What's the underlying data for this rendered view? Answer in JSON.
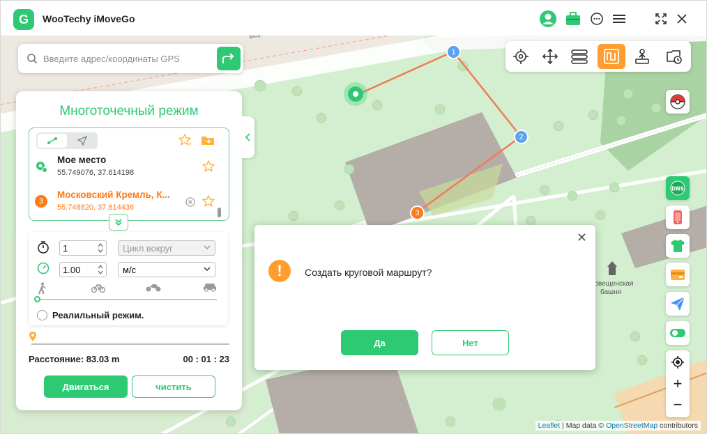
{
  "app": {
    "title": "WooTechy iMoveGo",
    "logo_letter": "G"
  },
  "search": {
    "placeholder": "Введите адрес/координаты GPS"
  },
  "map_labels": {
    "street": "Боровиц",
    "tower_line1": "говещенская",
    "tower_line2": "башня"
  },
  "panel": {
    "title": "Многоточечный режим",
    "points": [
      {
        "name": "Мое место",
        "coords": "55.749076, 37.614198",
        "color": "#2ec973"
      },
      {
        "name": "Московский Кремль, К...",
        "coords": "55.748820, 37.614436",
        "marker": "3",
        "color": "#ff7a1a"
      }
    ],
    "repeat_count": "1",
    "loop_option": "Цикл вокруг",
    "speed_value": "1.00",
    "speed_unit": "м/с",
    "realistic_mode": "Реалильный режим.",
    "distance": "Расстояние: 83.03 m",
    "time": "00 : 01 : 23",
    "move_button": "Двигаться",
    "clear_button": "чистить"
  },
  "route_markers": [
    "1",
    "2",
    "3"
  ],
  "dialog": {
    "message": "Создать круговой маршрут?",
    "yes": "Да",
    "no": "Нет",
    "close": "✕",
    "warn_glyph": "!"
  },
  "attribution": {
    "leaflet": "Leaflet",
    "sep": " | Map data © ",
    "osm": "OpenStreetMap",
    "suffix": " contributors"
  },
  "zoom": {
    "in": "+",
    "out": "−"
  },
  "colors": {
    "accent": "#2ec973",
    "active_mode": "#ff9d2f",
    "route_line": "#f07a58",
    "waypoint": "#5aa2f0"
  }
}
